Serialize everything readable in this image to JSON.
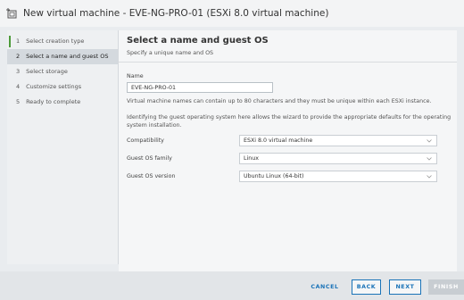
{
  "window": {
    "title": "New virtual machine - EVE-NG-PRO-01 (ESXi 8.0 virtual machine)",
    "icon": "vm-add-icon"
  },
  "steps": [
    {
      "num": "1",
      "label": "Select creation type",
      "state": "done"
    },
    {
      "num": "2",
      "label": "Select a name and guest OS",
      "state": "active"
    },
    {
      "num": "3",
      "label": "Select storage",
      "state": "pending"
    },
    {
      "num": "4",
      "label": "Customize settings",
      "state": "pending"
    },
    {
      "num": "5",
      "label": "Ready to complete",
      "state": "pending"
    }
  ],
  "page": {
    "title": "Select a name and guest OS",
    "subtitle": "Specify a unique name and OS"
  },
  "name_field": {
    "label": "Name",
    "value": "EVE-NG-PRO-01",
    "hint": "Virtual machine names can contain up to 80 characters and they must be unique within each ESXi instance."
  },
  "guest_os_info": {
    "line1": "Identifying the guest operating system here allows the wizard to provide the appropriate defaults for the operating",
    "line2": "system installation."
  },
  "fields": {
    "compatibility": {
      "label": "Compatibility",
      "value": "ESXi 8.0 virtual machine"
    },
    "guest_os_family": {
      "label": "Guest OS family",
      "value": "Linux"
    },
    "guest_os_version": {
      "label": "Guest OS version",
      "value": "Ubuntu Linux (64-bit)"
    }
  },
  "footer": {
    "cancel": "CANCEL",
    "back": "BACK",
    "next": "NEXT",
    "finish": "FINISH"
  },
  "colors": {
    "accent": "#1a73b8",
    "step_done": "#4d9b3a",
    "finish_disabled": "#c8cdd2"
  }
}
